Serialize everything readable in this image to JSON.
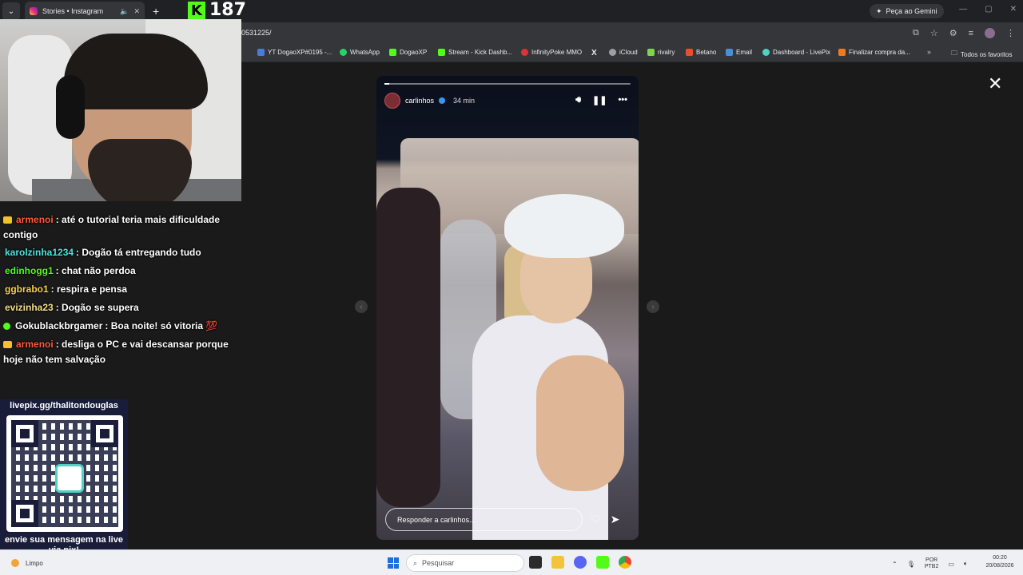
{
  "browser": {
    "tab_title": "Stories • Instagram",
    "address_fragment": "0531225/",
    "gemini_label": "Peça ao Gemini",
    "bookmarks": [
      {
        "label": "YT DogaoXP#0195 -...",
        "color": "#4a7bd6"
      },
      {
        "label": "WhatsApp",
        "color": "#25d366"
      },
      {
        "label": "DogaoXP",
        "color": "#53fc18"
      },
      {
        "label": "Stream - Kick Dashb...",
        "color": "#53fc18"
      },
      {
        "label": "InfinityPoke MMO",
        "color": "#d33"
      },
      {
        "label": "X",
        "color": "#111"
      },
      {
        "label": "iCloud",
        "color": "#9aa0a6"
      },
      {
        "label": "rivalry",
        "color": "#7bd64a"
      },
      {
        "label": "Betano",
        "color": "#e8502d"
      },
      {
        "label": "Email",
        "color": "#4a8fd6"
      },
      {
        "label": "Dashboard - LivePix",
        "color": "#4fd1c5"
      },
      {
        "label": "Finalizar compra da...",
        "color": "#f27a1a"
      }
    ],
    "bookmarks_more": "»",
    "all_bookmarks": "Todos os favoritos"
  },
  "stream": {
    "viewer_count": "187",
    "chat": [
      {
        "badge": "crown",
        "user": "armenoi",
        "color": "#ff5b3a",
        "text": ": até o tutorial teria mais dificuldade contigo"
      },
      {
        "badge": "",
        "user": "karolzinha1234",
        "color": "#4fe3e0",
        "text": ": Dogão tá entregando tudo"
      },
      {
        "badge": "",
        "user": "edinhogg1",
        "color": "#53fc18",
        "text": ": chat não perdoa"
      },
      {
        "badge": "",
        "user": "ggbrabo1",
        "color": "#f6d54a",
        "text": ": respira e pensa"
      },
      {
        "badge": "",
        "user": "evizinha23",
        "color": "#f3e08a",
        "text": ": Dogão se supera"
      },
      {
        "badge": "dot",
        "user": "Gokublackbrgamer",
        "color": "#ffffff",
        "text": ": Boa noite! só vitoria 💯"
      },
      {
        "badge": "crown",
        "user": "armenoi",
        "color": "#ff5b3a",
        "text": ": desliga o PC e vai descansar porque hoje não tem salvação"
      }
    ],
    "pix_url": "livepix.gg/thalitondouglas",
    "pix_message": "envie sua mensagem na live via pix!"
  },
  "story": {
    "username": "carlinhos",
    "time": "34 min",
    "progress": 0.02,
    "reply_placeholder": "Responder a carlinhos..."
  },
  "taskbar": {
    "weather": "Limpo",
    "search_placeholder": "Pesquisar",
    "lang_top": "POR",
    "lang_bottom": "PTB2",
    "time": "00:20",
    "date": "20/08/2026"
  }
}
